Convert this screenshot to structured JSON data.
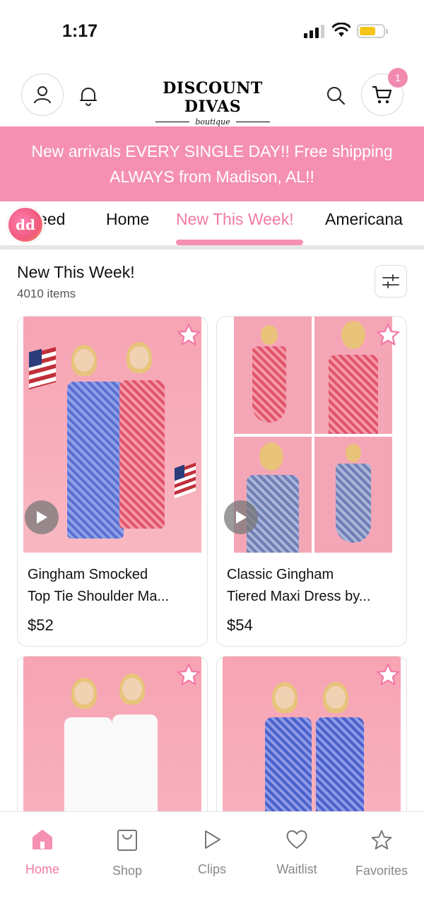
{
  "status_bar": {
    "time": "1:17"
  },
  "header": {
    "brand": "DISCOUNT DIVAS",
    "brand_sub": "boutique",
    "cart_count": "1"
  },
  "banner": {
    "line1": "New arrivals EVERY SINGLE DAY!! Free shipping",
    "line2": "ALWAYS from Madison, AL!!"
  },
  "tabs": {
    "logo_text": "dd",
    "items": [
      "Feed",
      "Home",
      "New This Week!",
      "Americana"
    ],
    "active": "New This Week!"
  },
  "section": {
    "title": "New This Week!",
    "count": "4010 items"
  },
  "products": [
    {
      "name": "Gingham Smocked Top Tie Shoulder Ma...",
      "name_line1": "Gingham Smocked",
      "name_line2": "Top Tie Shoulder Ma...",
      "price": "$52"
    },
    {
      "name": "Classic Gingham Tiered Maxi Dress by...",
      "name_line1": "Classic Gingham",
      "name_line2": "Tiered Maxi Dress by...",
      "price": "$54"
    },
    {
      "name": "",
      "price": ""
    },
    {
      "name": "",
      "price": ""
    }
  ],
  "bottom_nav": {
    "items": [
      {
        "label": "Home",
        "icon": "home-icon"
      },
      {
        "label": "Shop",
        "icon": "bag-icon"
      },
      {
        "label": "Clips",
        "icon": "play-icon"
      },
      {
        "label": "Waitlist",
        "icon": "heart-icon"
      },
      {
        "label": "Favorites",
        "icon": "star-icon"
      }
    ],
    "active": "Home"
  },
  "colors": {
    "accent": "#f590b3",
    "accent_text": "#f27aa6",
    "battery": "#f5c518"
  }
}
